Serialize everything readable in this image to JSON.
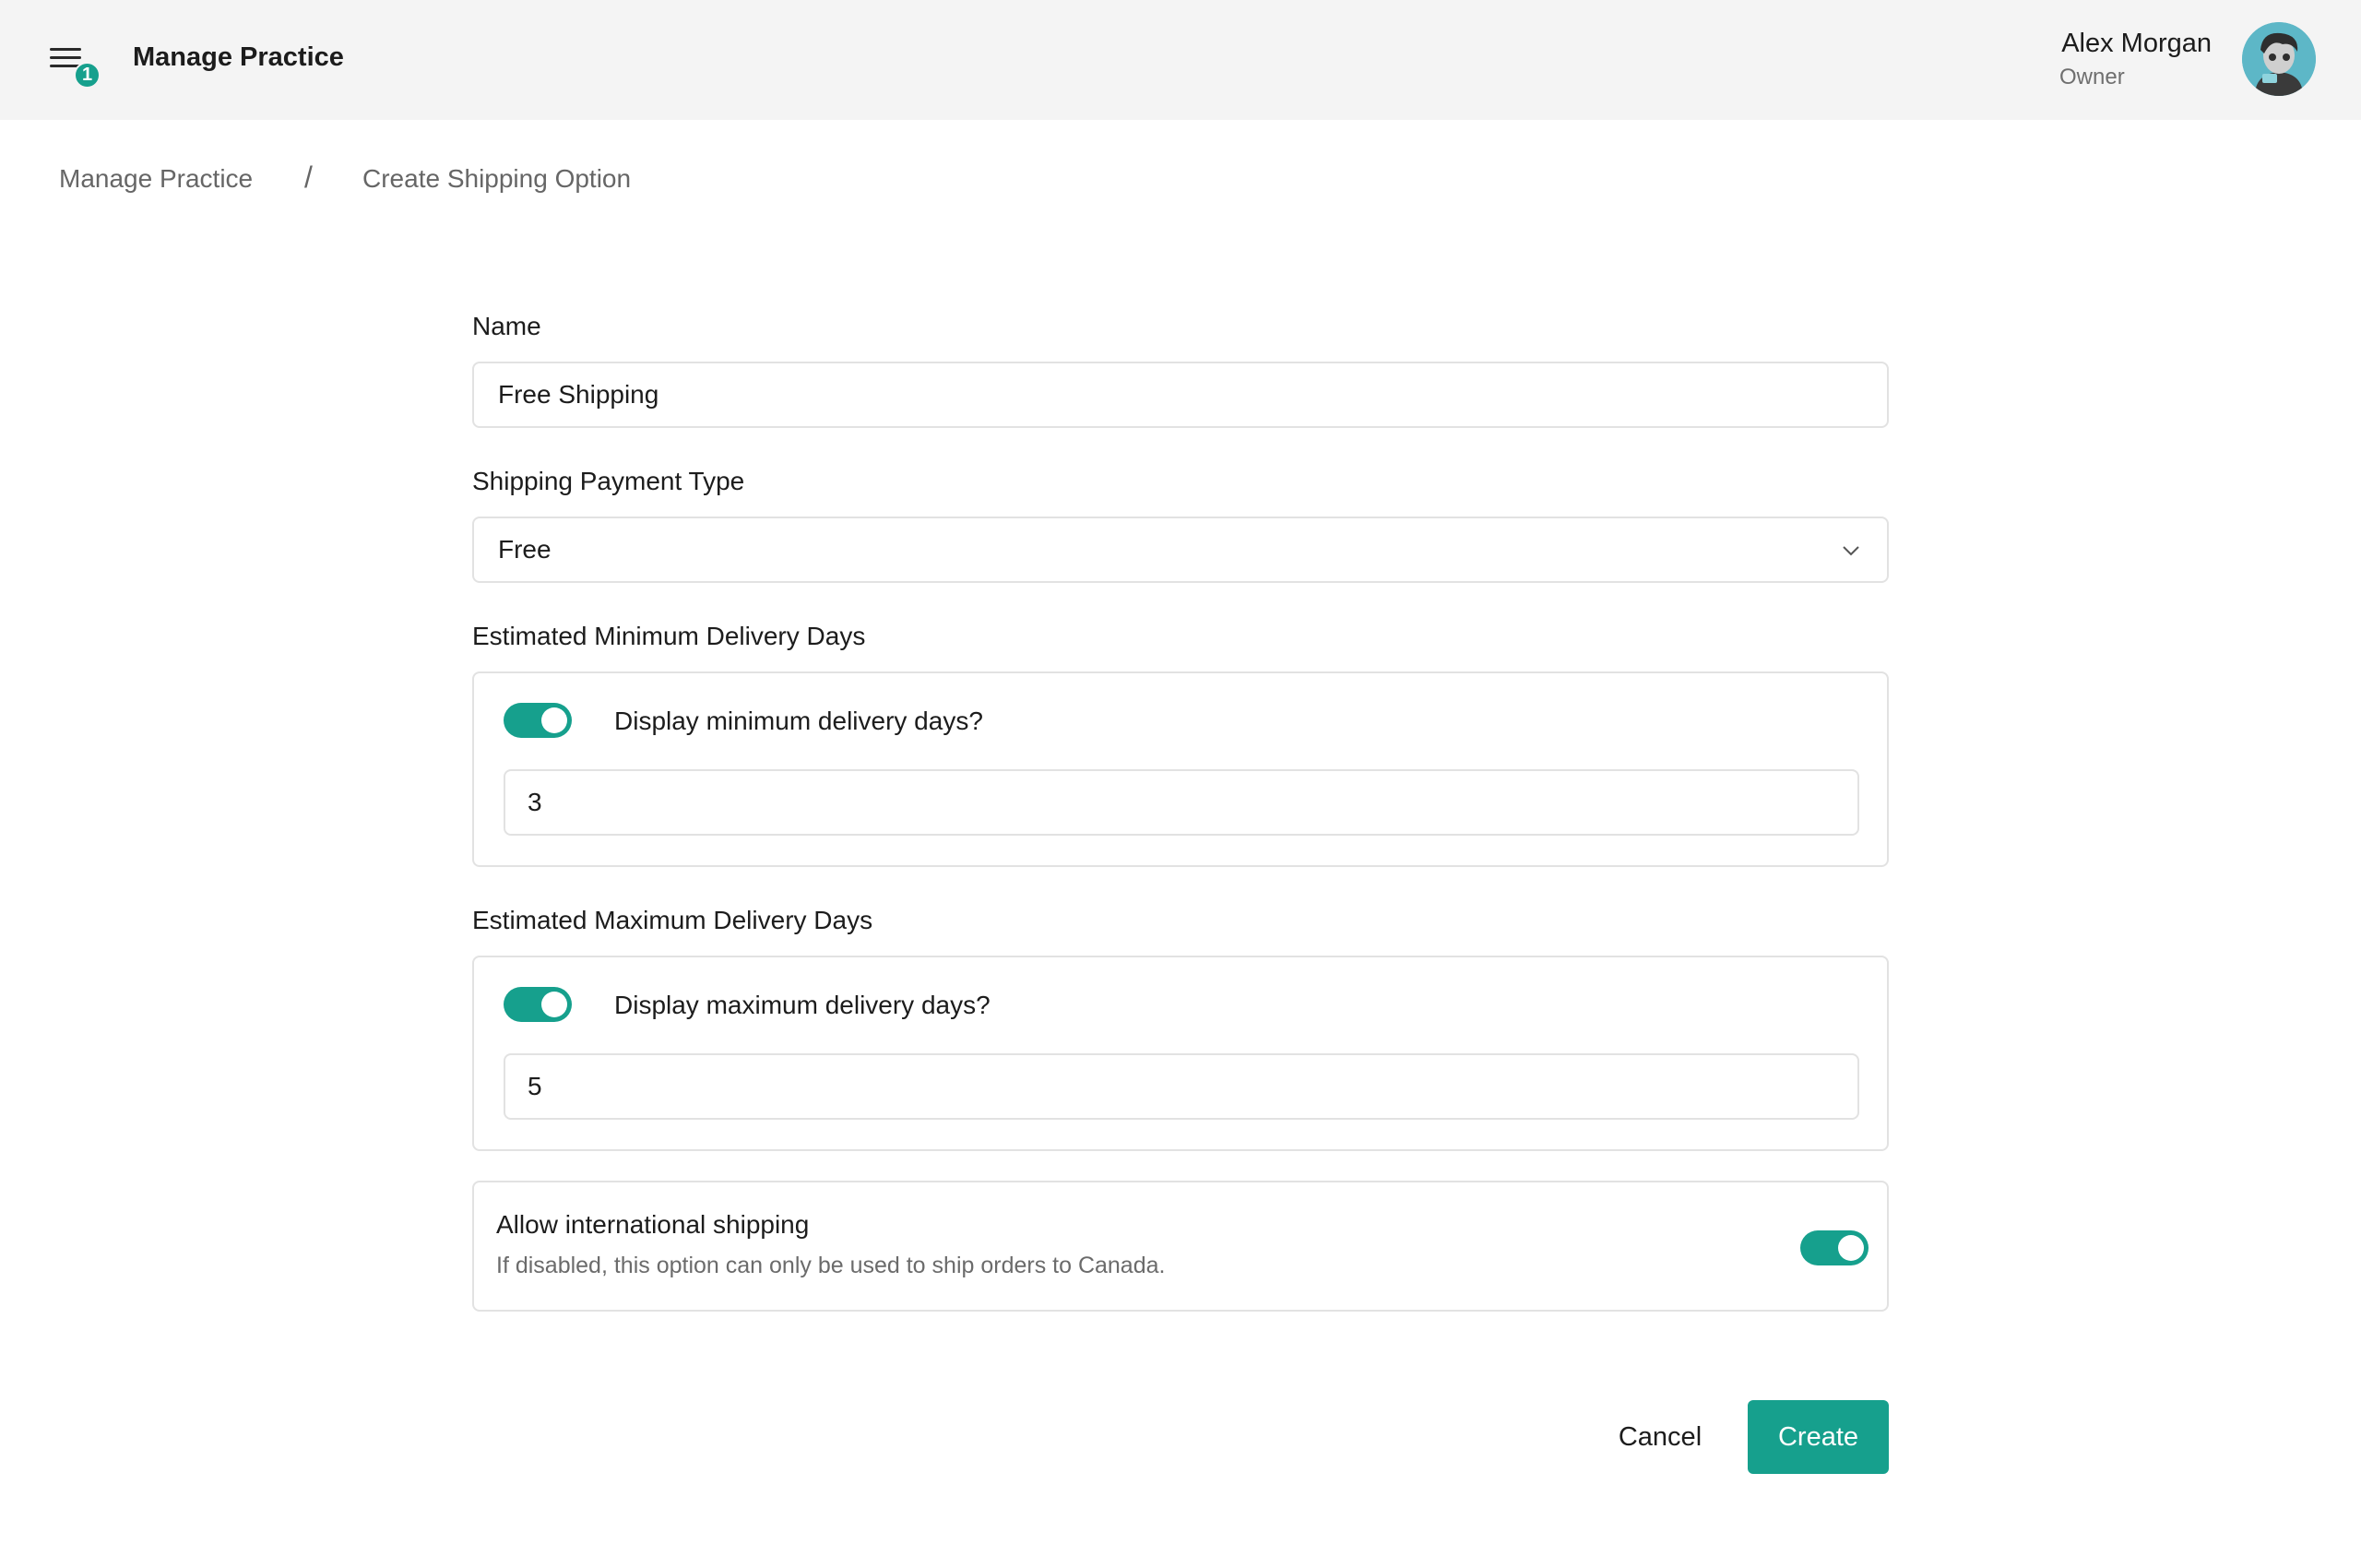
{
  "header": {
    "app_title": "Manage Practice",
    "menu_badge": "1",
    "user_name": "Alex Morgan",
    "user_role": "Owner"
  },
  "breadcrumb": {
    "items": [
      "Manage Practice",
      "Create Shipping Option"
    ],
    "separator": "/"
  },
  "form": {
    "name": {
      "label": "Name",
      "value": "Free Shipping"
    },
    "payment_type": {
      "label": "Shipping Payment Type",
      "value": "Free"
    },
    "min_days": {
      "label": "Estimated Minimum Delivery Days",
      "toggle_label": "Display minimum delivery days?",
      "toggle_on": true,
      "value": "3"
    },
    "max_days": {
      "label": "Estimated Maximum Delivery Days",
      "toggle_label": "Display maximum delivery days?",
      "toggle_on": true,
      "value": "5"
    },
    "international": {
      "title": "Allow international shipping",
      "description": "If disabled, this option can only be used to ship orders to Canada.",
      "toggle_on": true
    }
  },
  "actions": {
    "cancel": "Cancel",
    "create": "Create"
  },
  "colors": {
    "accent": "#16a08d",
    "header_bg": "#f4f4f4"
  }
}
